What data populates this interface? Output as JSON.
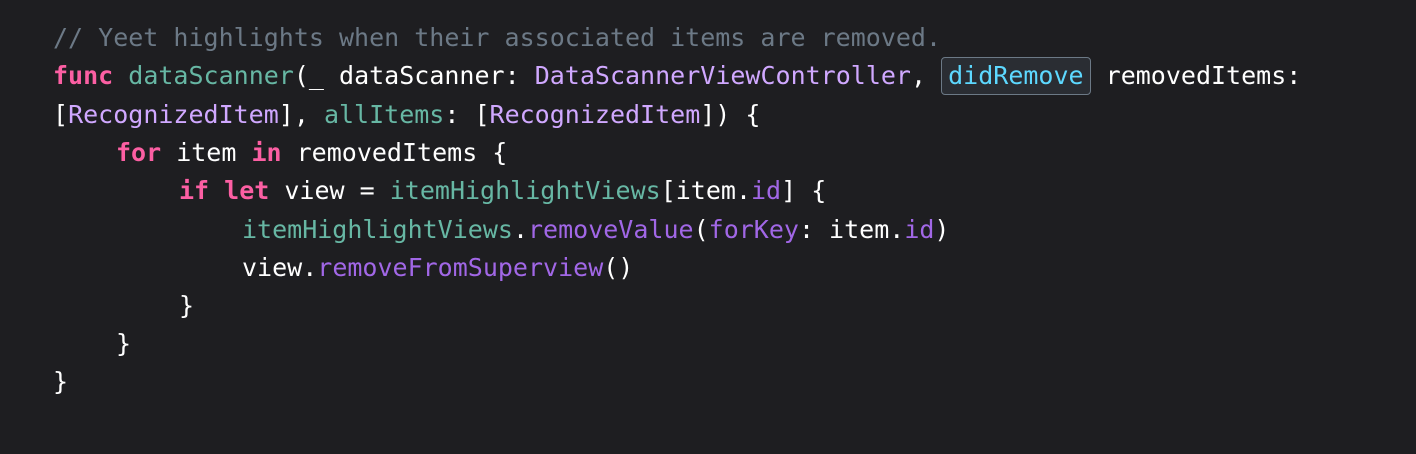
{
  "code": {
    "comment": "// Yeet highlights when their associated items are removed.",
    "l2": {
      "func_kw": "func",
      "func_name": "dataScanner",
      "open": "(_ ",
      "param1_name": "dataScanner",
      "colon1": ": ",
      "param1_type": "DataScannerViewController",
      "comma1": ", ",
      "highlighted_label": "didRemove",
      "space": " ",
      "param2_name": "removedItems",
      "colon2": ":"
    },
    "l3": {
      "open_bracket": "[",
      "type1": "RecognizedItem",
      "close1": "], ",
      "label": "allItems",
      "colon": ": ",
      "open_bracket2": "[",
      "type2": "RecognizedItem",
      "close2": "]) {"
    },
    "l4": {
      "for_kw": "for",
      "item": " item ",
      "in_kw": "in",
      "rest": " removedItems {"
    },
    "l5": {
      "if_kw": "if",
      "sp1": " ",
      "let_kw": "let",
      "mid": " view = ",
      "var": "itemHighlightViews",
      "bracket_open": "[item.",
      "prop": "id",
      "bracket_close": "] {"
    },
    "l6": {
      "var": "itemHighlightViews",
      "dot": ".",
      "method": "removeValue",
      "open": "(",
      "label": "forKey",
      "mid": ": item.",
      "prop": "id",
      "close": ")"
    },
    "l7": {
      "obj": "view.",
      "method": "removeFromSuperview",
      "call": "()"
    },
    "l8": "}",
    "l9": "}",
    "l10": "}"
  },
  "colors": {
    "background": "#1e1e21",
    "comment": "#6c7986",
    "keyword": "#fc5fa3",
    "function_name": "#67b7a4",
    "type": "#d0a8ff",
    "method": "#a167e6",
    "highlight": "#5dd8ff"
  }
}
